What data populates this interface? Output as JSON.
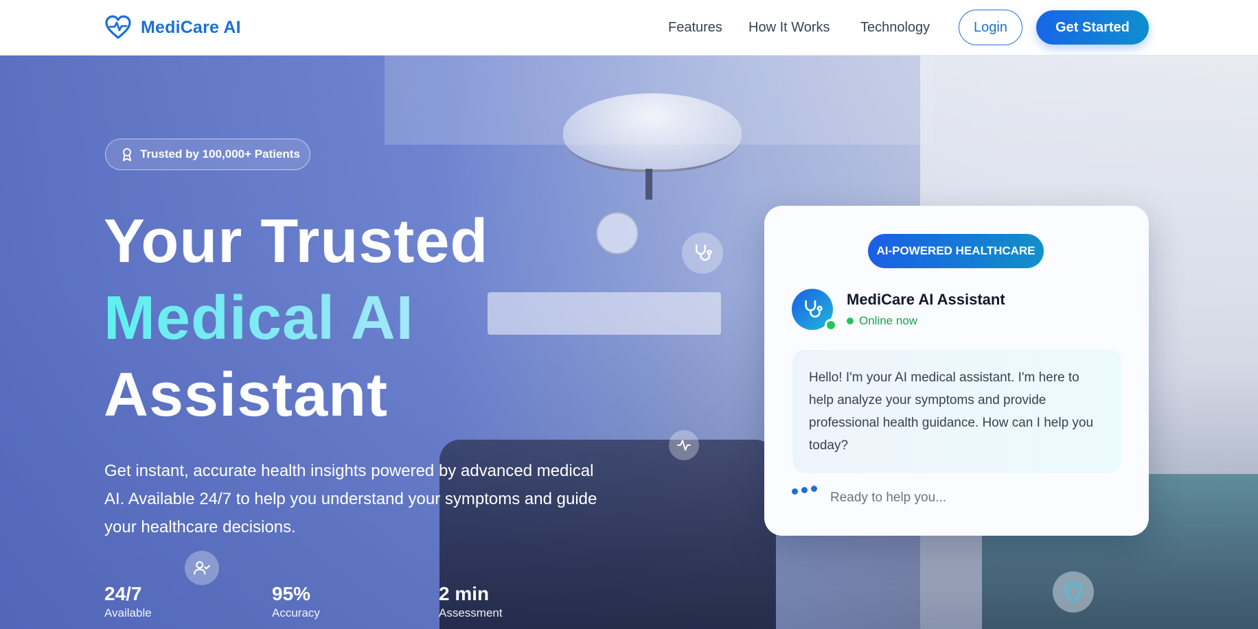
{
  "brand": {
    "name": "MediCare AI",
    "icon": "heart-pulse-icon",
    "color": "#1a6fd8"
  },
  "nav": {
    "links": [
      "Features",
      "How It Works",
      "Technology"
    ],
    "login_label": "Login",
    "cta_label": "Get Started"
  },
  "hero": {
    "badge": {
      "icon": "award-ribbon-icon",
      "text": "Trusted by 100,000+ Patients"
    },
    "headline": {
      "line1": "Your Trusted",
      "line2": "Medical AI",
      "line3": "Assistant"
    },
    "subtext": "Get instant, accurate health insights powered by advanced medical AI. Available 24/7 to help you understand your symptoms and guide your healthcare decisions.",
    "stats": [
      {
        "value": "24/7",
        "label": "Available"
      },
      {
        "value": "95%",
        "label": "Accuracy"
      },
      {
        "value": "2 min",
        "label": "Assessment"
      }
    ],
    "floating_icons": [
      "stethoscope-icon",
      "activity-pulse-icon",
      "user-check-icon",
      "shield-icon"
    ]
  },
  "chat_card": {
    "pill": "AI-POWERED HEALTHCARE",
    "assistant_name": "MediCare AI Assistant",
    "status": "Online now",
    "message": "Hello! I'm your AI medical assistant. I'm here to help analyze your symptoms and provide professional health guidance. How can I help you today?",
    "typing_text": "Ready to help you..."
  },
  "colors": {
    "primary": "#1a6fd8",
    "accent_cyan": "#5ef0ef",
    "online_green": "#22c55e"
  }
}
